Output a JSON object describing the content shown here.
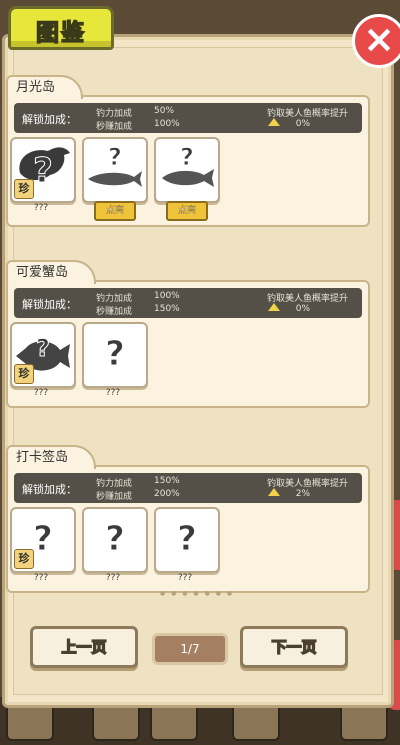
{
  "header": {
    "title": "图鉴",
    "close_icon": "close-x-icon"
  },
  "bonus_labels": {
    "unlock": "解锁加成：",
    "fishing_power": "钓力加成",
    "gold_per_sec": "秒赚加成",
    "mermaid_rate": "钓取美人鱼概率提升"
  },
  "islands": [
    {
      "name": "月光岛",
      "fishing_power": "50%",
      "gold_per_sec": "100%",
      "mermaid_rate": "0%",
      "cards": [
        {
          "name": "???",
          "fish": "anglerfish-silhouette",
          "rare": "珍",
          "button": ""
        },
        {
          "name": "",
          "fish": "longfish-silhouette",
          "rare": "",
          "button": "点亮"
        },
        {
          "name": "",
          "fish": "fish-silhouette",
          "rare": "",
          "button": "点亮"
        }
      ]
    },
    {
      "name": "可爱蟹岛",
      "fishing_power": "100%",
      "gold_per_sec": "150%",
      "mermaid_rate": "0%",
      "cards": [
        {
          "name": "???",
          "fish": "reef-fish-silhouette",
          "rare": "珍",
          "button": ""
        },
        {
          "name": "???",
          "fish": "",
          "rare": "",
          "button": ""
        }
      ]
    },
    {
      "name": "打卡签岛",
      "fishing_power": "150%",
      "gold_per_sec": "200%",
      "mermaid_rate": "2%",
      "cards": [
        {
          "name": "???",
          "fish": "",
          "rare": "珍",
          "button": ""
        },
        {
          "name": "???",
          "fish": "",
          "rare": "",
          "button": ""
        },
        {
          "name": "???",
          "fish": "",
          "rare": "",
          "button": ""
        }
      ]
    }
  ],
  "pagination": {
    "prev": "上一页",
    "next": "下一页",
    "page": "1/7"
  },
  "rare_mark": "珍",
  "question_mark": "?"
}
